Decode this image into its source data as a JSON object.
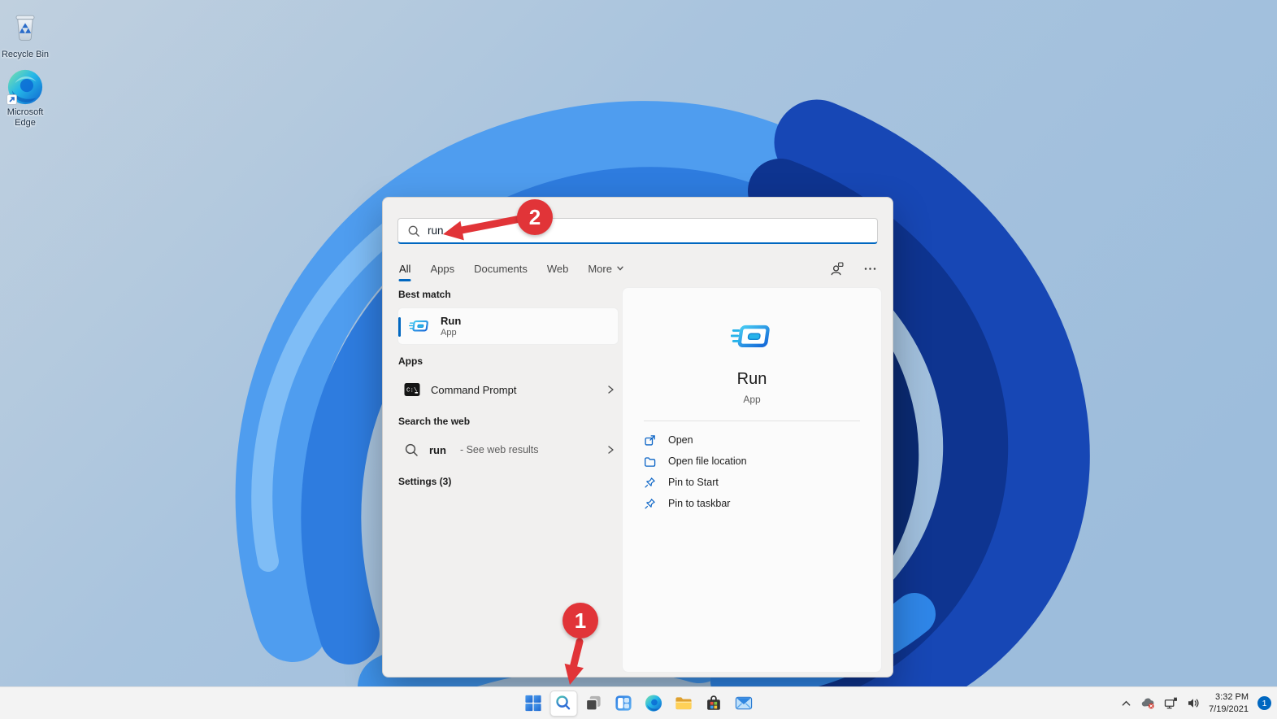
{
  "desktop": {
    "icons": [
      {
        "label": "Recycle Bin"
      },
      {
        "label": "Microsoft Edge"
      }
    ]
  },
  "search_panel": {
    "query": "run",
    "active_tab": "All",
    "tabs": [
      {
        "label": "All"
      },
      {
        "label": "Apps"
      },
      {
        "label": "Documents"
      },
      {
        "label": "Web"
      },
      {
        "label": "More"
      }
    ],
    "sections": {
      "best_match": {
        "header": "Best match",
        "item": {
          "title": "Run",
          "subtitle": "App"
        }
      },
      "apps": {
        "header": "Apps",
        "items": [
          {
            "title": "Command Prompt"
          }
        ]
      },
      "web": {
        "header": "Search the web",
        "items": [
          {
            "title": "run",
            "note": "- See web results"
          }
        ]
      },
      "settings": {
        "header": "Settings (3)"
      }
    },
    "detail": {
      "title": "Run",
      "subtitle": "App",
      "actions": [
        {
          "label": "Open"
        },
        {
          "label": "Open file location"
        },
        {
          "label": "Pin to Start"
        },
        {
          "label": "Pin to taskbar"
        }
      ]
    }
  },
  "taskbar": {
    "buttons": [
      {
        "name": "start"
      },
      {
        "name": "search",
        "active": true
      },
      {
        "name": "task-view"
      },
      {
        "name": "widgets"
      },
      {
        "name": "edge"
      },
      {
        "name": "file-explorer"
      },
      {
        "name": "store"
      },
      {
        "name": "mail"
      }
    ],
    "tray": {
      "time": "3:32 PM",
      "date": "7/19/2021",
      "notification_count": "1"
    }
  },
  "annotations": {
    "step_search_icon": {
      "number": "1"
    },
    "step_search_box": {
      "number": "2"
    }
  },
  "icons": {
    "search_input": "search-icon",
    "account": "account-icon",
    "more_options": "more-options-icon",
    "chevron_right": "chevron-right-icon",
    "run_app": "run-app-icon",
    "command_prompt": "command-prompt-icon",
    "cmd_prompt_icon_text": "C:\\",
    "open": "open-icon",
    "open_file_location": "folder-icon",
    "pin": "pin-icon",
    "tray_chevron": "chevron-up-icon",
    "tray_cloud": "onedrive-error-icon",
    "tray_network": "network-icon",
    "tray_volume": "volume-icon"
  },
  "colors": {
    "accent": "#0067c0",
    "annotation_red": "#e13438",
    "taskbar_bg": "#f3f3f3",
    "window_bg": "#f1f0ef",
    "card_bg": "#fbfbfb"
  }
}
